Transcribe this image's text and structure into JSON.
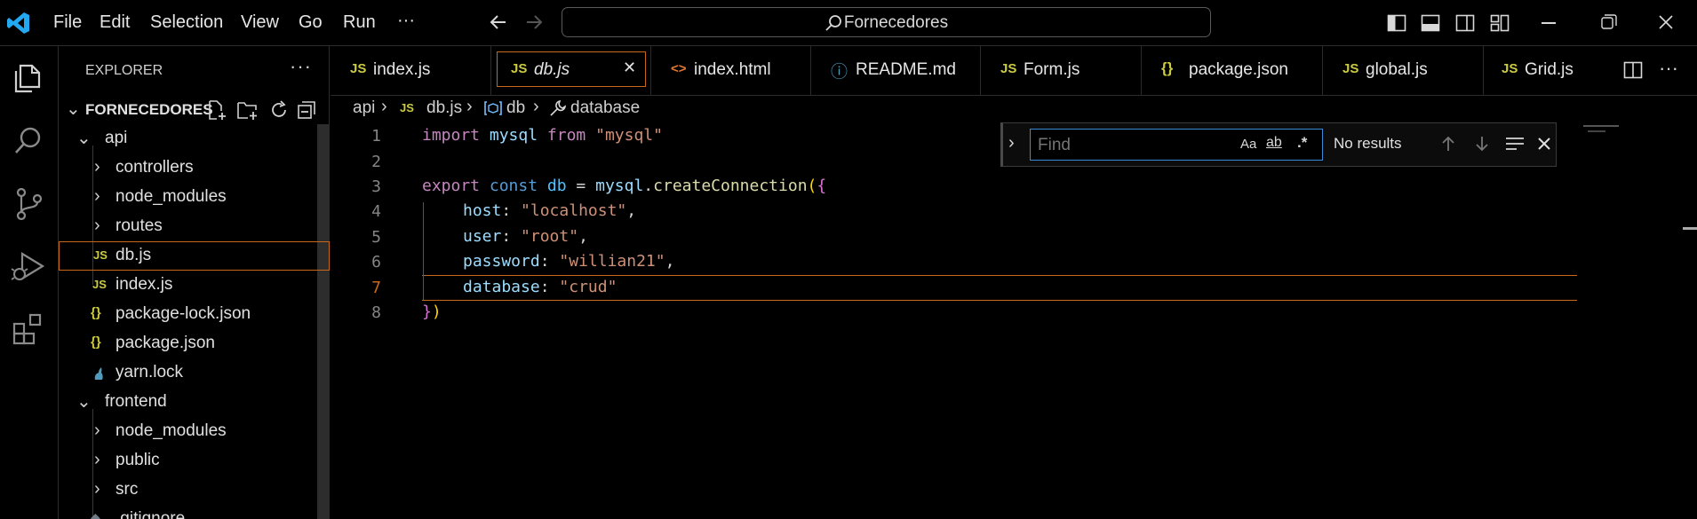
{
  "menu": [
    "File",
    "Edit",
    "Selection",
    "View",
    "Go",
    "Run",
    "···"
  ],
  "command_center": {
    "text": "Fornecedores"
  },
  "sidebar": {
    "title": "EXPLORER",
    "more": "···",
    "root": "FORNECEDORES",
    "items": [
      {
        "label": "api",
        "kind": "folder-open"
      },
      {
        "label": "controllers",
        "kind": "folder"
      },
      {
        "label": "node_modules",
        "kind": "folder"
      },
      {
        "label": "routes",
        "kind": "folder"
      },
      {
        "label": "db.js",
        "kind": "js",
        "icon": "JS"
      },
      {
        "label": "index.js",
        "kind": "js",
        "icon": "JS"
      },
      {
        "label": "package-lock.json",
        "kind": "json",
        "icon": "{}"
      },
      {
        "label": "package.json",
        "kind": "json",
        "icon": "{}"
      },
      {
        "label": "yarn.lock",
        "kind": "yarn"
      },
      {
        "label": "frontend",
        "kind": "folder-open"
      },
      {
        "label": "node_modules",
        "kind": "folder"
      },
      {
        "label": "public",
        "kind": "folder"
      },
      {
        "label": "src",
        "kind": "folder"
      },
      {
        "label": ".gitignore",
        "kind": "git"
      }
    ]
  },
  "tabs": [
    {
      "label": "index.js",
      "icon": "JS"
    },
    {
      "label": "db.js",
      "icon": "JS",
      "close": "✕"
    },
    {
      "label": "index.html",
      "icon": "<>"
    },
    {
      "label": "README.md",
      "icon": "ⓘ"
    },
    {
      "label": "Form.js",
      "icon": "JS"
    },
    {
      "label": "package.json",
      "icon": "{}"
    },
    {
      "label": "global.js",
      "icon": "JS"
    },
    {
      "label": "Grid.js",
      "icon": "JS"
    }
  ],
  "breadcrumb": {
    "folder": "api",
    "file": "db.js",
    "symbol": "db",
    "property": "database",
    "file_icon": "JS"
  },
  "editor": {
    "line_numbers": [
      "1",
      "2",
      "3",
      "4",
      "5",
      "6",
      "7",
      "8"
    ],
    "code": {
      "l1_import": "import",
      "l1_mysql": "mysql",
      "l1_from": "from",
      "l1_str": "\"mysql\"",
      "l3_export": "export",
      "l3_const": "const",
      "l3_db": "db",
      "l3_eq": " = ",
      "l3_mysql": "mysql",
      "l3_dot": ".",
      "l3_fn": "createConnection",
      "l3_paren": "(",
      "l3_brace": "{",
      "l4_key": "host",
      "l4_val": "\"localhost\"",
      "l5_key": "user",
      "l5_val": "\"root\"",
      "l6_key": "password",
      "l6_val": "\"willian21\"",
      "l7_key": "database",
      "l7_val": "\"crud\"",
      "l8_brace": "}",
      "l8_paren": ")",
      "colon": ": ",
      "comma": ","
    }
  },
  "find": {
    "placeholder": "Find",
    "match_case": "Aa",
    "whole_word": "ab",
    "regex": ".*",
    "result": "No results"
  },
  "colors": {
    "accent": "#0e639c",
    "highlight_border": "#c7681a",
    "js_icon": "#cbcb41",
    "json_icon": "#cbcb41",
    "html_icon": "#e37933",
    "info_icon": "#519aba"
  }
}
